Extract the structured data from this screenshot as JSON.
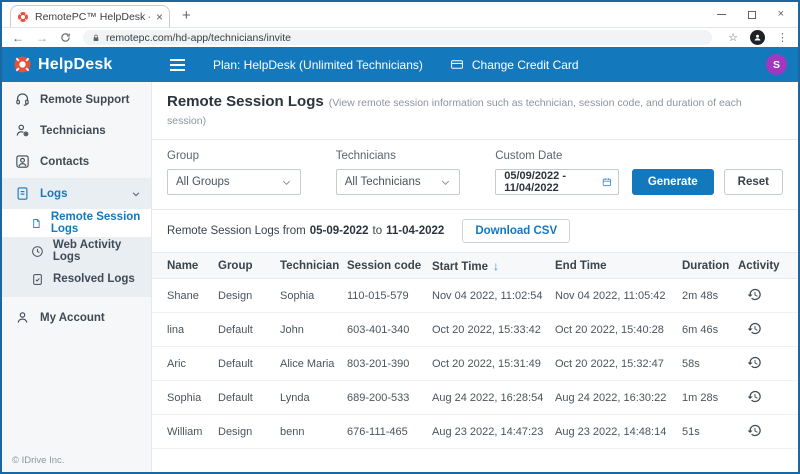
{
  "browser": {
    "tab_title": "RemotePC™ HelpDesk - Remote",
    "url": "remotepc.com/hd-app/technicians/invite"
  },
  "header": {
    "logo_text": "HelpDesk",
    "plan_label": "Plan: HelpDesk (Unlimited Technicians)",
    "change_credit_card_label": "Change Credit Card",
    "avatar_initial": "S"
  },
  "sidebar": {
    "items": [
      {
        "label": "Remote Support"
      },
      {
        "label": "Technicians"
      },
      {
        "label": "Contacts"
      },
      {
        "label": "Logs",
        "children": [
          {
            "label": "Remote Session Logs",
            "active": true
          },
          {
            "label": "Web Activity Logs"
          },
          {
            "label": "Resolved Logs"
          }
        ]
      },
      {
        "label": "My Account"
      }
    ],
    "footer": "© IDrive Inc."
  },
  "page": {
    "title": "Remote Session Logs",
    "subtitle": "(View remote session information such as technician, session code, and duration of each session)"
  },
  "filters": {
    "group_label": "Group",
    "group_value": "All Groups",
    "technicians_label": "Technicians",
    "technicians_value": "All Technicians",
    "custom_date_label": "Custom Date",
    "custom_date_value": "05/09/2022 - 11/04/2022",
    "generate_label": "Generate",
    "reset_label": "Reset"
  },
  "summary": {
    "prefix": "Remote Session Logs from",
    "from_date": "05-09-2022",
    "to_word": "to",
    "to_date": "11-04-2022",
    "download_csv_label": "Download CSV"
  },
  "table": {
    "columns": [
      "Name",
      "Group",
      "Technician",
      "Session code",
      "Start Time",
      "End Time",
      "Duration",
      "Activity"
    ],
    "sorted_column": "Start Time",
    "sort_direction": "descending",
    "rows": [
      {
        "name": "Shane",
        "group": "Design",
        "technician": "Sophia",
        "session_code": "110-015-579",
        "start_time": "Nov 04 2022, 11:02:54",
        "end_time": "Nov 04 2022, 11:05:42",
        "duration": "2m 48s"
      },
      {
        "name": "lina",
        "group": "Default",
        "technician": "John",
        "session_code": "603-401-340",
        "start_time": "Oct 20 2022, 15:33:42",
        "end_time": "Oct 20 2022, 15:40:28",
        "duration": "6m 46s"
      },
      {
        "name": "Aric",
        "group": "Default",
        "technician": "Alice Maria",
        "session_code": "803-201-390",
        "start_time": "Oct 20 2022, 15:31:49",
        "end_time": "Oct 20 2022, 15:32:47",
        "duration": "58s"
      },
      {
        "name": "Sophia",
        "group": "Default",
        "technician": "Lynda",
        "session_code": "689-200-533",
        "start_time": "Aug 24 2022, 16:28:54",
        "end_time": "Aug 24 2022, 16:30:22",
        "duration": "1m 28s"
      },
      {
        "name": "William",
        "group": "Design",
        "technician": "benn",
        "session_code": "676-111-465",
        "start_time": "Aug 23 2022, 14:47:23",
        "end_time": "Aug 23 2022, 14:48:14",
        "duration": "51s"
      }
    ]
  },
  "colors": {
    "header_blue": "#1478bd",
    "accent_blue": "#2e8bd4",
    "logo_red": "#e8503a",
    "avatar_purple": "#a238c0",
    "sidebar_bg": "#f5f7f8",
    "logs_group_bg": "#e9eef2"
  }
}
